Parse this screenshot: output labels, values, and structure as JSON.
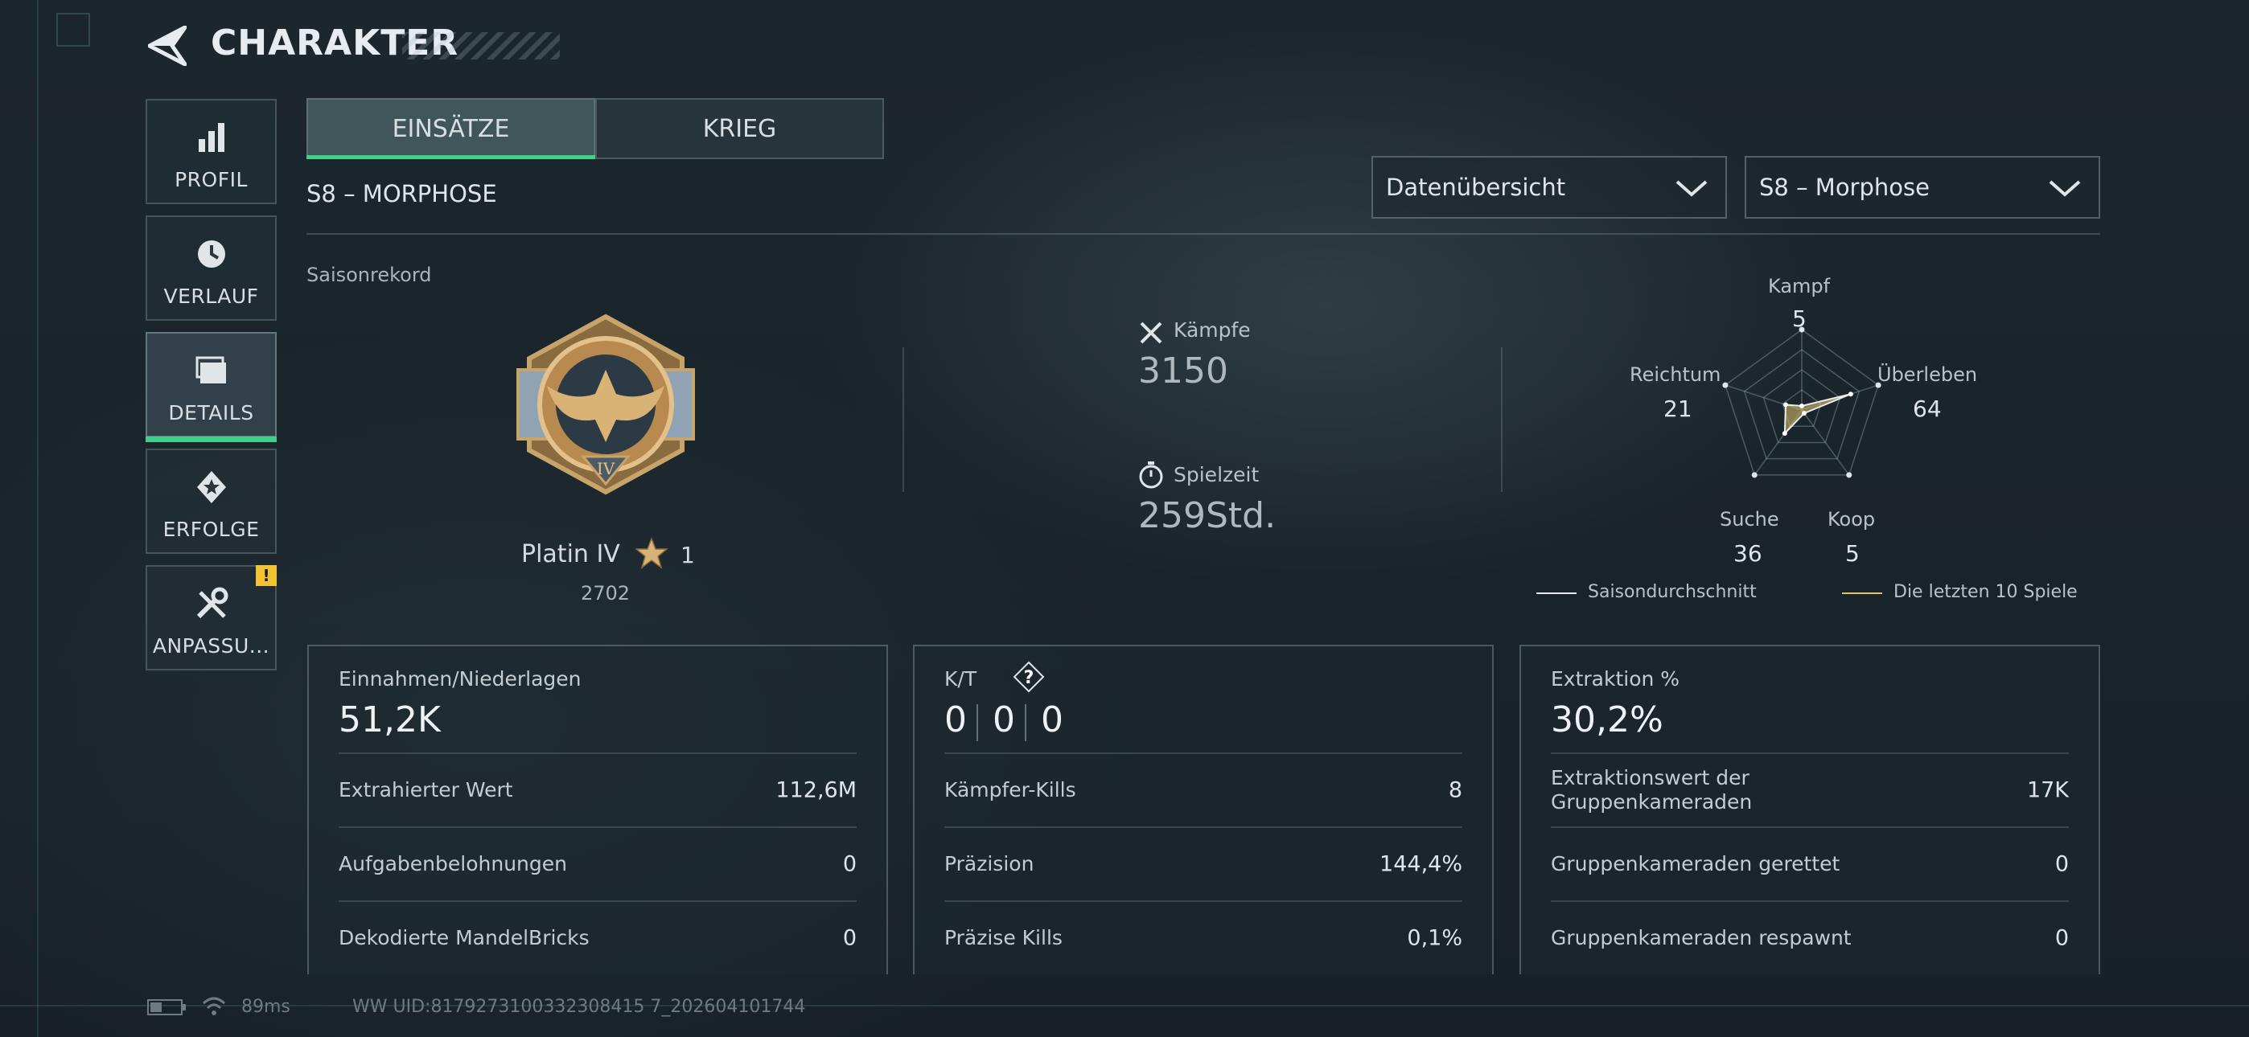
{
  "header": {
    "title": "CHARAKTER"
  },
  "sidebar": {
    "items": [
      {
        "label": "PROFIL",
        "icon": "bar-chart-icon"
      },
      {
        "label": "VERLAUF",
        "icon": "history-icon"
      },
      {
        "label": "DETAILS",
        "icon": "folder-icon",
        "active": true
      },
      {
        "label": "ERFOLGE",
        "icon": "achievement-icon"
      },
      {
        "label": "ANPASSU...",
        "icon": "tools-icon",
        "badge": "!"
      }
    ]
  },
  "tabs": [
    {
      "label": "EINSÄTZE",
      "active": true
    },
    {
      "label": "KRIEG",
      "active": false
    }
  ],
  "season_title": "S8 – MORPHOSE",
  "dropdowns": {
    "view": {
      "value": "Datenübersicht"
    },
    "season": {
      "value": "S8 – Morphose"
    }
  },
  "season_record": {
    "label": "Saisonrekord",
    "rank_name": "Platin IV",
    "rank_stars": "1",
    "rank_points": "2702",
    "medal_numeral": "IV"
  },
  "overview": {
    "fights_label": "Kämpfe",
    "fights_value": "3150",
    "playtime_label": "Spielzeit",
    "playtime_value": "259Std."
  },
  "radar": {
    "axes": [
      {
        "label": "Kampf",
        "value": "5",
        "level": 5
      },
      {
        "label": "Überleben",
        "value": "64",
        "level": 64
      },
      {
        "label": "Koop",
        "value": "5",
        "level": 5
      },
      {
        "label": "Suche",
        "value": "36",
        "level": 36
      },
      {
        "label": "Reichtum",
        "value": "21",
        "level": 21
      }
    ],
    "legend_avg": "Saisondurchschnitt",
    "legend_recent": "Die letzten 10 Spiele",
    "avg_color": "#e8ecee",
    "recent_color": "#e3c36a"
  },
  "cards": {
    "income": {
      "header": "Einnahmen/Niederlagen",
      "value": "51,2K",
      "rows": [
        {
          "label": "Extrahierter Wert",
          "value": "112,6M"
        },
        {
          "label": "Aufgabenbelohnungen",
          "value": "0"
        },
        {
          "label": "Dekodierte MandelBricks",
          "value": "0"
        }
      ]
    },
    "kd": {
      "header": "K/T",
      "help": "?",
      "values": [
        "0",
        "0",
        "0"
      ],
      "rows": [
        {
          "label": "Kämpfer-Kills",
          "value": "8"
        },
        {
          "label": "Präzision",
          "value": "144,4%"
        },
        {
          "label": "Präzise Kills",
          "value": "0,1%"
        }
      ]
    },
    "extraction": {
      "header": "Extraktion %",
      "value": "30,2%",
      "rows": [
        {
          "label": "Extraktionswert der Gruppenkameraden",
          "value": "17K"
        },
        {
          "label": "Gruppenkameraden gerettet",
          "value": "0"
        },
        {
          "label": "Gruppenkameraden respawnt",
          "value": "0"
        }
      ]
    }
  },
  "footer": {
    "ping": "89ms",
    "uid": "WW UID:8179273100332308415 7_202604101744"
  },
  "colors": {
    "accent": "#3fd08a",
    "warning": "#f2c230"
  }
}
